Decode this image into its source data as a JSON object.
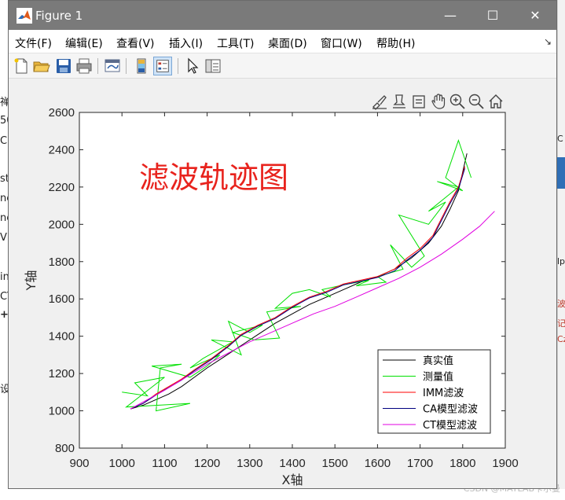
{
  "window": {
    "title": "Figure 1",
    "controls": {
      "minimize": "—",
      "maximize": "☐",
      "close": "✕"
    }
  },
  "menu": {
    "items": [
      "文件(F)",
      "编辑(E)",
      "查看(V)",
      "插入(I)",
      "工具(T)",
      "桌面(D)",
      "窗口(W)",
      "帮助(H)"
    ]
  },
  "toolbar": {
    "buttons": [
      "new-figure",
      "open-file",
      "save",
      "print",
      "link-plot",
      "insert-colorbar",
      "insert-legend",
      "edit-plot",
      "property-inspector"
    ]
  },
  "axes_toolbar": {
    "buttons": [
      "brush",
      "data-cursor",
      "pan",
      "zoom-in",
      "zoom-out",
      "home"
    ]
  },
  "background": {
    "fragments": [
      "禅",
      "50",
      "C",
      "st",
      "ne",
      "ne",
      "V",
      "in",
      "CT",
      "+",
      "设",
      "C",
      "lp",
      "波",
      "记",
      "Cz"
    ]
  },
  "watermark": "CSDN @MATLAB卡尔曼",
  "chart_data": {
    "type": "line",
    "annotation": "滤波轨迹图",
    "xlabel": "X轴",
    "ylabel": "Y轴",
    "xlim": [
      900,
      1900
    ],
    "ylim": [
      800,
      2600
    ],
    "xticks": [
      900,
      1000,
      1100,
      1200,
      1300,
      1400,
      1500,
      1600,
      1700,
      1800,
      1900
    ],
    "yticks": [
      800,
      1000,
      1200,
      1400,
      1600,
      1800,
      2000,
      2200,
      2400,
      2600
    ],
    "grid": false,
    "legend_position": "bottom-right",
    "series": [
      {
        "name": "真实值",
        "color": "#000000",
        "x": [
          1020,
          1050,
          1080,
          1110,
          1140,
          1170,
          1200,
          1240,
          1280,
          1320,
          1360,
          1400,
          1440,
          1480,
          1520,
          1560,
          1600,
          1640,
          1680,
          1720,
          1750,
          1770,
          1790,
          1800,
          1810
        ],
        "y": [
          1010,
          1030,
          1060,
          1090,
          1130,
          1180,
          1230,
          1290,
          1350,
          1410,
          1470,
          1520,
          1570,
          1610,
          1650,
          1690,
          1720,
          1760,
          1820,
          1900,
          1990,
          2080,
          2180,
          2280,
          2380
        ]
      },
      {
        "name": "测量值",
        "color": "#00e000",
        "x": [
          1000,
          1060,
          1030,
          1100,
          1010,
          1160,
          1080,
          1090,
          1140,
          1070,
          1160,
          1200,
          1230,
          1160,
          1190,
          1260,
          1210,
          1280,
          1250,
          1300,
          1330,
          1260,
          1310,
          1370,
          1340,
          1420,
          1360,
          1400,
          1440,
          1490,
          1470,
          1530,
          1580,
          1550,
          1620,
          1600,
          1660,
          1630,
          1680,
          1710,
          1650,
          1720,
          1760,
          1720,
          1790,
          1740,
          1800,
          1760,
          1790,
          1820
        ],
        "y": [
          1100,
          1080,
          1150,
          1180,
          1020,
          1040,
          1000,
          1230,
          1250,
          1240,
          1180,
          1240,
          1300,
          1230,
          1280,
          1370,
          1380,
          1300,
          1480,
          1420,
          1460,
          1420,
          1380,
          1390,
          1530,
          1560,
          1550,
          1630,
          1650,
          1610,
          1650,
          1680,
          1700,
          1670,
          1690,
          1720,
          1760,
          1890,
          1770,
          1830,
          2050,
          2000,
          2120,
          2070,
          2200,
          2230,
          2180,
          2250,
          2450,
          2250
        ]
      },
      {
        "name": "IMM滤波",
        "color": "#ff0000",
        "x": [
          1020,
          1050,
          1080,
          1110,
          1140,
          1170,
          1210,
          1250,
          1280,
          1320,
          1360,
          1400,
          1440,
          1480,
          1520,
          1560,
          1600,
          1640,
          1670,
          1700,
          1730,
          1750,
          1770,
          1790,
          1805
        ],
        "y": [
          1010,
          1040,
          1090,
          1130,
          1170,
          1220,
          1280,
          1350,
          1410,
          1460,
          1500,
          1560,
          1610,
          1640,
          1680,
          1700,
          1720,
          1760,
          1820,
          1870,
          1940,
          2030,
          2120,
          2200,
          2310
        ]
      },
      {
        "name": "CA模型滤波",
        "color": "#000080",
        "x": [
          1020,
          1050,
          1080,
          1110,
          1140,
          1170,
          1210,
          1250,
          1280,
          1320,
          1360,
          1400,
          1440,
          1480,
          1520,
          1560,
          1600,
          1640,
          1670,
          1700,
          1730,
          1750,
          1770,
          1790,
          1805
        ],
        "y": [
          1010,
          1040,
          1085,
          1125,
          1165,
          1215,
          1275,
          1345,
          1405,
          1455,
          1495,
          1555,
          1605,
          1635,
          1675,
          1695,
          1715,
          1750,
          1810,
          1860,
          1930,
          2020,
          2110,
          2190,
          2300
        ]
      },
      {
        "name": "CT模型滤波",
        "color": "#e000e0",
        "x": [
          1020,
          1060,
          1100,
          1150,
          1200,
          1250,
          1300,
          1350,
          1400,
          1450,
          1500,
          1550,
          1600,
          1650,
          1700,
          1750,
          1800,
          1840,
          1875
        ],
        "y": [
          1010,
          1060,
          1110,
          1180,
          1250,
          1310,
          1370,
          1420,
          1470,
          1520,
          1560,
          1610,
          1660,
          1710,
          1770,
          1840,
          1920,
          1990,
          2070
        ]
      }
    ]
  }
}
